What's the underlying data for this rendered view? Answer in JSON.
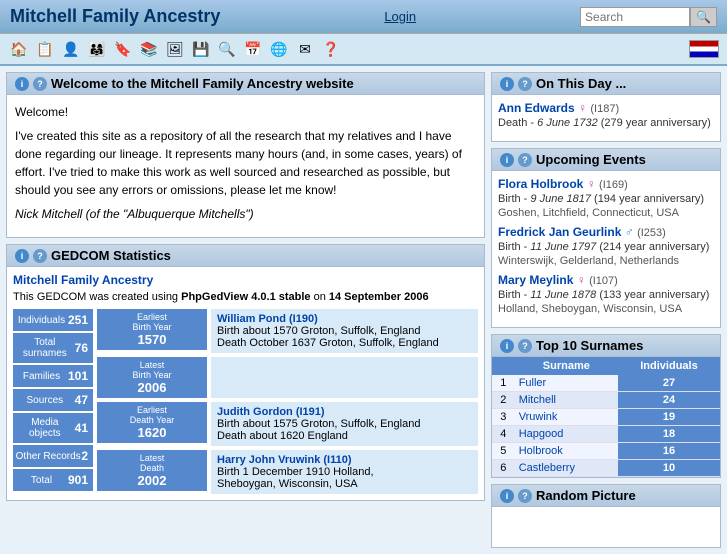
{
  "header": {
    "title": "Mitchell Family Ancestry",
    "login_label": "Login",
    "search_placeholder": "Search"
  },
  "toolbar": {
    "icons": [
      "🏠",
      "📄",
      "👤",
      "🔖",
      "🔒",
      "📋",
      "📄",
      "💾",
      "🔍",
      "🖼",
      "🌐",
      "✉",
      "❓"
    ]
  },
  "welcome": {
    "panel_title": "Welcome to the Mitchell Family Ancestry website",
    "greeting": "Welcome!",
    "body1": "I've created this site as a repository of all the research that my relatives and I have done regarding our lineage. It represents many hours (and, in some cases, years) of effort. I've tried to make this work as well sourced and researched as possible, but should you see any errors or omissions, please let me know!",
    "body2": "Nick Mitchell (of the \"Albuquerque Mitchells\")"
  },
  "gedcom": {
    "panel_title": "GEDCOM Statistics",
    "site_title": "Mitchell Family Ancestry",
    "description_before": "This GEDCOM was created using ",
    "software": "PhpGedView 4.0.1 stable",
    "description_after": " on ",
    "date": "14 September 2006",
    "stats": [
      {
        "label": "Individuals",
        "value": "251"
      },
      {
        "label": "Total surnames",
        "value": "76"
      },
      {
        "label": "Families",
        "value": "101"
      },
      {
        "label": "Sources",
        "value": "47"
      },
      {
        "label": "Media objects",
        "value": "41"
      },
      {
        "label": "Other Records",
        "value": "2"
      },
      {
        "label": "Total",
        "value": "901"
      }
    ],
    "records": [
      {
        "year_label": "Earliest Birth Year",
        "year": "1570",
        "name": "William Pond",
        "id": "I190",
        "detail1": "Birth about 1570 Groton, Suffolk, England",
        "detail2": "Death October 1637 Groton, Suffolk, England"
      },
      {
        "year_label": "Latest Birth Year",
        "year": "2006",
        "name": null,
        "id": null,
        "detail1": null,
        "detail2": null
      },
      {
        "year_label": "Earliest Death Year",
        "year": "1620",
        "name": "Judith Gordon",
        "id": "I191",
        "detail1": "Birth about 1575 Groton, Suffolk, England",
        "detail2": "Death about 1620 England"
      },
      {
        "year_label": "Latest Death",
        "year": "2002",
        "name": "Harry John Vruwink",
        "id": "I110",
        "detail1": "Birth 1 December 1910 Holland,",
        "detail2": "Sheboygan, Wisconsin, USA"
      }
    ]
  },
  "on_this_day": {
    "panel_title": "On This Day ...",
    "entries": [
      {
        "name": "Ann Edwards",
        "gender": "♀",
        "id": "I187",
        "event": "Death",
        "date": "6 June 1732",
        "extra": "(279 year anniversary)"
      }
    ]
  },
  "upcoming": {
    "panel_title": "Upcoming Events",
    "entries": [
      {
        "name": "Flora Holbrook",
        "gender": "♀",
        "id": "I169",
        "event": "Birth",
        "date": "9 June 1817",
        "extra": "(194 year anniversary)",
        "place": "Goshen, Litchfield, Connecticut, USA"
      },
      {
        "name": "Fredrick Jan Geurlink",
        "gender": "♂",
        "id": "I253",
        "event": "Birth",
        "date": "11 June 1797",
        "extra": "(214 year anniversary)",
        "place": "Winterswijk, Gelderland, Netherlands"
      },
      {
        "name": "Mary Meylink",
        "gender": "♀",
        "id": "I107",
        "event": "Birth",
        "date": "11 June 1878",
        "extra": "(133 year anniversary)",
        "place": "Holland, Sheboygan, Wisconsin, USA"
      }
    ]
  },
  "top10": {
    "panel_title": "Top 10 Surnames",
    "col_surname": "Surname",
    "col_individuals": "Individuals",
    "rows": [
      {
        "rank": "1",
        "surname": "Fuller",
        "count": "27"
      },
      {
        "rank": "2",
        "surname": "Mitchell",
        "count": "24"
      },
      {
        "rank": "3",
        "surname": "Vruwink",
        "count": "19"
      },
      {
        "rank": "4",
        "surname": "Hapgood",
        "count": "18"
      },
      {
        "rank": "5",
        "surname": "Holbrook",
        "count": "16"
      },
      {
        "rank": "6",
        "surname": "Castleberry",
        "count": "10"
      }
    ]
  },
  "random_picture": {
    "panel_title": "Random Picture"
  }
}
